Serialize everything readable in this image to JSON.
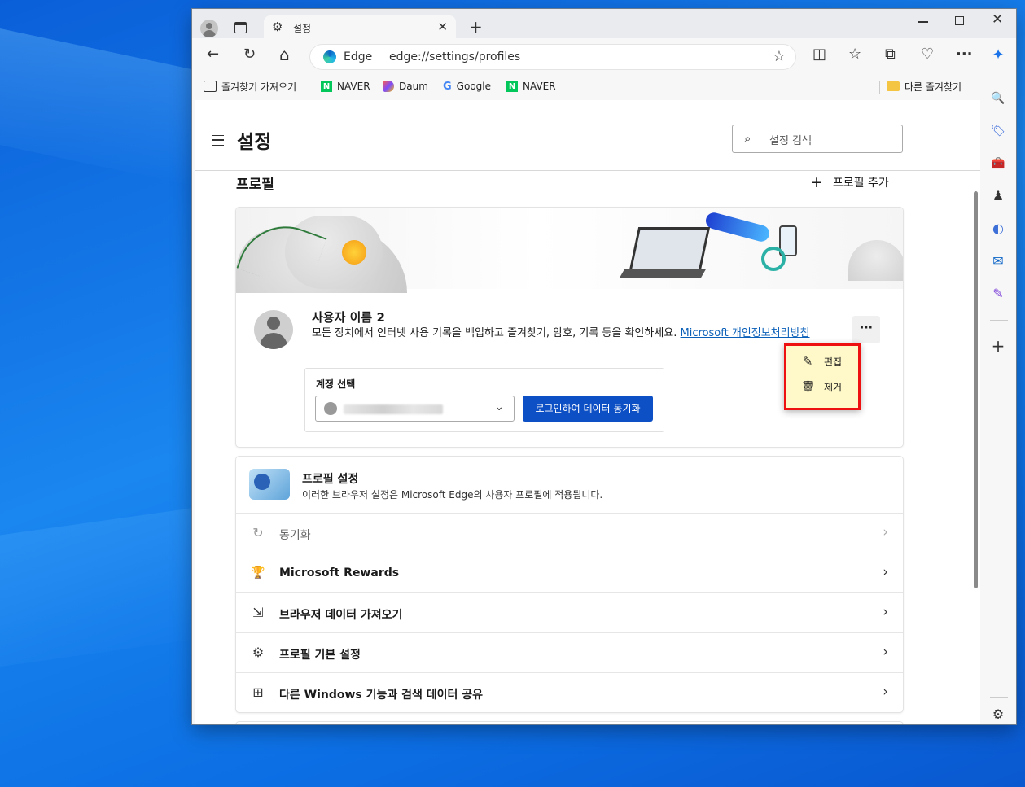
{
  "window": {
    "tab_title": "설정",
    "tab_close": "✕",
    "new_tab": "+",
    "minimize": "",
    "close": "✕"
  },
  "toolbar": {
    "back": "←",
    "refresh": "↻",
    "home": "⌂",
    "edge_label": "Edge",
    "url": "edge://settings/profiles",
    "favorite_star": "☆",
    "split_icon": "◫",
    "favorites_icon": "☆",
    "collections_icon": "⧉",
    "health_icon": "♡",
    "more": "···"
  },
  "bookmarks": {
    "items": [
      {
        "label": "즐겨찾기 가져오기",
        "icon": "import-icon"
      },
      {
        "label": "NAVER",
        "icon": "naver-icon"
      },
      {
        "label": "Daum",
        "icon": "daum-icon"
      },
      {
        "label": "Google",
        "icon": "google-icon"
      },
      {
        "label": "NAVER",
        "icon": "naver-icon"
      }
    ],
    "other_favorites": "다른 즐겨찾기",
    "naver_letter": "N",
    "google_letter": "G"
  },
  "sidebar": {
    "copilot": "✦",
    "search": "🔍",
    "shopping": "🏷",
    "tools": "🧰",
    "games": "♟",
    "m365": "◐",
    "outlook": "✉",
    "designer": "✎",
    "add": "+",
    "settings": "⚙"
  },
  "header": {
    "title": "설정",
    "search_placeholder": "설정 검색",
    "search_icon": "⌕"
  },
  "profile": {
    "section_title": "프로필",
    "add_profile": "프로필 추가",
    "add_plus": "+",
    "user_name": "사용자 이름 2",
    "description": "모든 장치에서 인터넷 사용 기록을 백업하고 즐겨찾기, 암호, 기록 등을 확인하세요.",
    "privacy_link": "Microsoft 개인정보처리방침",
    "more_button": "···",
    "account_label": "계정 선택",
    "account_chevron": "⌄",
    "sync_button": "로그인하여 데이터 동기화",
    "context_menu": {
      "edit": "편집",
      "edit_icon": "✎",
      "remove": "제거",
      "remove_icon": "🗑"
    }
  },
  "profile_settings": {
    "title": "프로필 설정",
    "description": "이러한 브라우저 설정은 Microsoft Edge의 사용자 프로필에 적용됩니다.",
    "rows": [
      {
        "label": "동기화",
        "icon": "↻",
        "disabled": true
      },
      {
        "label": "Microsoft Rewards",
        "icon": "🏆",
        "disabled": false
      },
      {
        "label": "브라우저 데이터 가져오기",
        "icon": "⇲",
        "disabled": false
      },
      {
        "label": "프로필 기본 설정",
        "icon": "⚙",
        "disabled": false
      },
      {
        "label": "다른 Windows 기능과 검색 데이터 공유",
        "icon": "⊞",
        "disabled": false
      }
    ],
    "chevron": "›"
  }
}
